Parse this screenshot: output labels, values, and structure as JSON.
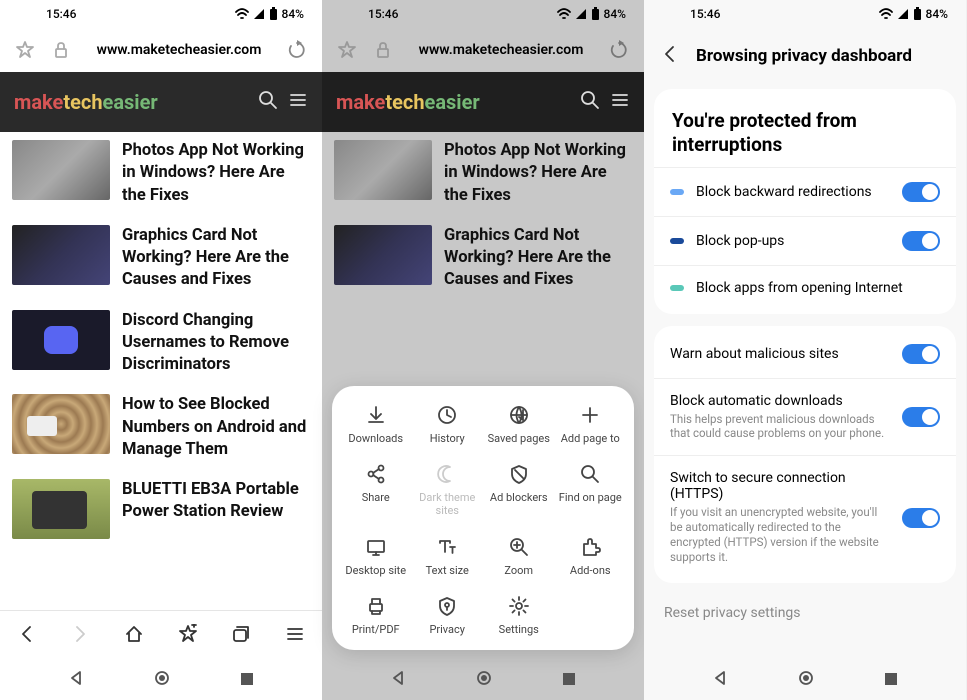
{
  "status": {
    "time": "15:46",
    "battery": "84%"
  },
  "url": "www.maketecheasier.com",
  "logo": {
    "p1": "make",
    "p2": "tech",
    "p3": "easier"
  },
  "articles": [
    {
      "title": "Photos App Not Working in Windows? Here Are the Fixes"
    },
    {
      "title": "Graphics Card Not Working? Here Are the Causes and Fixes"
    },
    {
      "title": "Discord Changing Usernames to Remove Discriminators"
    },
    {
      "title": "How to See Blocked Numbers on Android and Manage Them"
    },
    {
      "title": "BLUETTI EB3A Portable Power Station Review"
    }
  ],
  "menu": [
    {
      "label": "Downloads"
    },
    {
      "label": "History"
    },
    {
      "label": "Saved pages"
    },
    {
      "label": "Add page to"
    },
    {
      "label": "Share"
    },
    {
      "label": "Dark theme sites",
      "disabled": true
    },
    {
      "label": "Ad blockers"
    },
    {
      "label": "Find on page"
    },
    {
      "label": "Desktop site"
    },
    {
      "label": "Text size"
    },
    {
      "label": "Zoom"
    },
    {
      "label": "Add-ons"
    },
    {
      "label": "Print/PDF"
    },
    {
      "label": "Privacy"
    },
    {
      "label": "Settings"
    }
  ],
  "settings": {
    "title": "Browsing privacy dashboard",
    "section1": {
      "heading": "You're protected from interruptions",
      "rows": [
        {
          "label": "Block backward redirections",
          "color": "#6aa8f5"
        },
        {
          "label": "Block pop-ups",
          "color": "#1a4a9a"
        },
        {
          "label": "Block apps from opening Internet",
          "color": "#5ac8b8",
          "no_toggle": true
        }
      ]
    },
    "section2": {
      "rows": [
        {
          "label": "Warn about malicious sites"
        },
        {
          "label": "Block automatic downloads",
          "sub": "This helps prevent malicious downloads that could cause problems on your phone."
        },
        {
          "label": "Switch to secure connection (HTTPS)",
          "sub": "If you visit an unencrypted website, you'll be automatically redirected to the encrypted (HTTPS) version if the website supports it."
        }
      ]
    },
    "reset": "Reset privacy settings"
  }
}
